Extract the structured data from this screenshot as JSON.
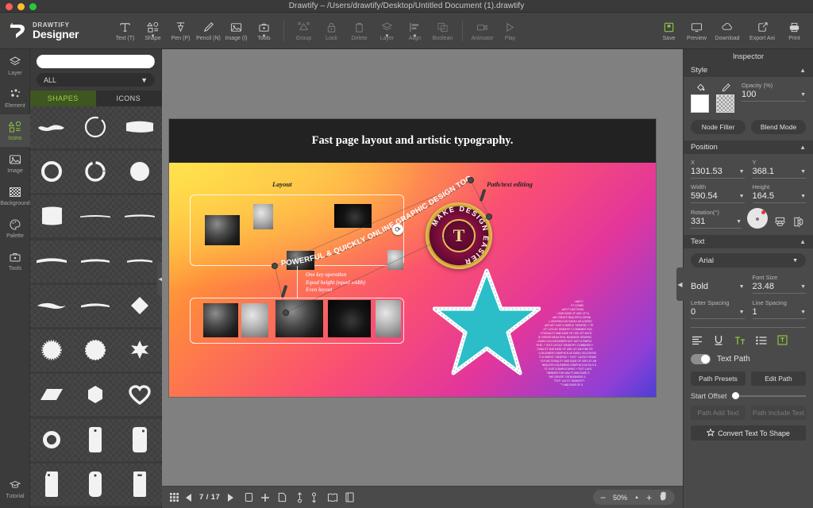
{
  "window": {
    "title": "Drawtify – /Users/drawtify/Desktop/Untitled Document (1).drawtify"
  },
  "brand": {
    "top": "DRAWTIFY",
    "bottom": "Designer"
  },
  "toolbar": {
    "left_tools": [
      {
        "label": "Text (T)",
        "icon": "text-icon",
        "caret": false
      },
      {
        "label": "Shape",
        "icon": "shape-icon",
        "caret": true
      },
      {
        "label": "Pen (P)",
        "icon": "pen-icon",
        "caret": false
      },
      {
        "label": "Pencil (N)",
        "icon": "pencil-icon",
        "caret": false
      },
      {
        "label": "Image (I)",
        "icon": "image-icon",
        "caret": false
      },
      {
        "label": "Tools",
        "icon": "toolbox-icon",
        "caret": true
      }
    ],
    "object_tools": [
      {
        "label": "Group",
        "icon": "group-icon",
        "caret": false
      },
      {
        "label": "Lock",
        "icon": "lock-icon",
        "caret": false
      },
      {
        "label": "Delete",
        "icon": "trash-icon",
        "caret": false
      },
      {
        "label": "Layer",
        "icon": "layers-icon",
        "caret": true
      },
      {
        "label": "Align",
        "icon": "align-icon",
        "caret": true
      },
      {
        "label": "Boolean",
        "icon": "boolean-icon",
        "caret": false
      }
    ],
    "anim_tools": [
      {
        "label": "Animator",
        "icon": "animator-icon"
      },
      {
        "label": "Play",
        "icon": "play-icon"
      }
    ],
    "right_tools": [
      {
        "label": "Save",
        "icon": "save-icon"
      },
      {
        "label": "Preview",
        "icon": "monitor-icon"
      },
      {
        "label": "Download",
        "icon": "cloud-download-icon"
      },
      {
        "label": "Export Ani",
        "icon": "export-icon"
      },
      {
        "label": "Print",
        "icon": "printer-icon"
      }
    ]
  },
  "rail": {
    "items": [
      {
        "label": "Layer",
        "icon": "layers-icon",
        "active": false
      },
      {
        "label": "Element",
        "icon": "element-icon",
        "active": false
      },
      {
        "label": "Icons",
        "icon": "icons-icon",
        "active": true
      },
      {
        "label": "Image",
        "icon": "image-icon",
        "active": false
      },
      {
        "label": "Background",
        "icon": "background-icon",
        "active": false
      },
      {
        "label": "Palette",
        "icon": "palette-icon",
        "active": false
      },
      {
        "label": "Tools",
        "icon": "toolbox-icon",
        "active": false
      }
    ],
    "tutorial": {
      "label": "Tutorial",
      "icon": "graduation-cap-icon"
    }
  },
  "library_panel": {
    "search_placeholder": "",
    "search_value": "",
    "category": "ALL",
    "tabs": [
      {
        "label": "SHAPES",
        "active": true
      },
      {
        "label": "ICONS",
        "active": false
      }
    ],
    "shapes": [
      "brush-stroke-bowtie",
      "brush-circle-ring-rough",
      "brush-block-wide",
      "circle-ring-thick",
      "circle-ring-brush",
      "circle-filled-rough",
      "brush-square-block",
      "brush-line-thin",
      "brush-line-thin-2",
      "brush-line-wide",
      "brush-line-medium",
      "brush-line-short",
      "brush-line-rough",
      "brush-line-tapered",
      "diamond",
      "sunburst-circle",
      "circle-scalloped",
      "six-point-star",
      "parallelogram",
      "hexagon",
      "heart-outline",
      "donut-small",
      "tag-rounded-rect",
      "tag-rect-tall",
      "tag-label-left",
      "tag-label-round",
      "tag-label-slot"
    ]
  },
  "canvas": {
    "artboard": {
      "headline": "Fast page layout and artistic typography.",
      "label_layout": "Layout",
      "label_path": "Path/text editing",
      "key_lines": [
        "One key operation",
        "Equal height (equal width)",
        "Even layout"
      ],
      "seal_ring_text": "MAKE DESIGN EASIER",
      "seal_monogram": "T",
      "path_text": "POWERFUL & QUICKLY ONLINE GRAPHIC DESIGN TOOL",
      "wordcloud_text": "LAYOUT GRAPHIC TEXT COMBINES FUN DESIGNER NOT JUST A SIMPLE GRAPHIC LET ANYONE CREATE BEAUTIFUL DESIGNS AS EASILY AS A DESIGNER FUNCTIONALITY AND EASE OF USE"
    }
  },
  "statusbar": {
    "grid_icon": "grid-icon",
    "prev_icon": "prev-page-icon",
    "page_indicator": "7 / 17",
    "next_icon": "next-page-icon",
    "actions": [
      "copy-page-icon",
      "add-page-icon",
      "duplicate-page-icon",
      "move-up-icon",
      "move-down-icon",
      "spread-view-icon",
      "single-view-icon"
    ],
    "zoom_out": "−",
    "zoom_value": "50%",
    "zoom_caret": "▲",
    "zoom_in": "+",
    "hand_icon": "hand-icon"
  },
  "inspector": {
    "title": "Inspector",
    "style": {
      "header": "Style",
      "fill_icon": "fill-bucket-icon",
      "stroke_icon": "stroke-brush-icon",
      "fill_color": "#ffffff",
      "opacity_label": "Opacity (%)",
      "opacity_value": "100",
      "node_filter": "Node Filter",
      "blend_mode": "Blend Mode"
    },
    "position": {
      "header": "Position",
      "x_label": "X",
      "x_value": "1301.53",
      "y_label": "Y",
      "y_value": "368.1",
      "w_label": "Width",
      "w_value": "590.54",
      "h_label": "Height",
      "h_value": "164.5",
      "rot_label": "Rotation(°)",
      "rot_value": "331",
      "flip_v_icon": "flip-vertical-icon",
      "flip_h_icon": "flip-horizontal-icon"
    },
    "text": {
      "header": "Text",
      "font_family": "Arial",
      "font_weight": "Bold",
      "font_size_label": "Font Size",
      "font_size": "23.48",
      "letter_spacing_label": "Letter Spacing",
      "letter_spacing": "0",
      "line_spacing_label": "Line Spacing",
      "line_spacing": "1",
      "align_icons": [
        "align-left-icon",
        "underline-icon",
        "text-case-icon",
        "list-icon",
        "text-box-icon"
      ],
      "text_path_label": "Text Path",
      "text_path_on": true,
      "path_presets": "Path Presets",
      "edit_path": "Edit Path",
      "start_offset_label": "Start Offset",
      "path_add_text": "Path Add Text",
      "path_include_text": "Path Include Text",
      "convert_label": "Convert Text To Shape",
      "convert_icon": "star-icon"
    }
  },
  "colors": {
    "accent_green": "#8dc63f",
    "panel_bg": "#3b3b3b",
    "toolbar_bg": "#434343",
    "inspector_bg": "#4a4a4a",
    "canvas_bg": "#808080"
  }
}
